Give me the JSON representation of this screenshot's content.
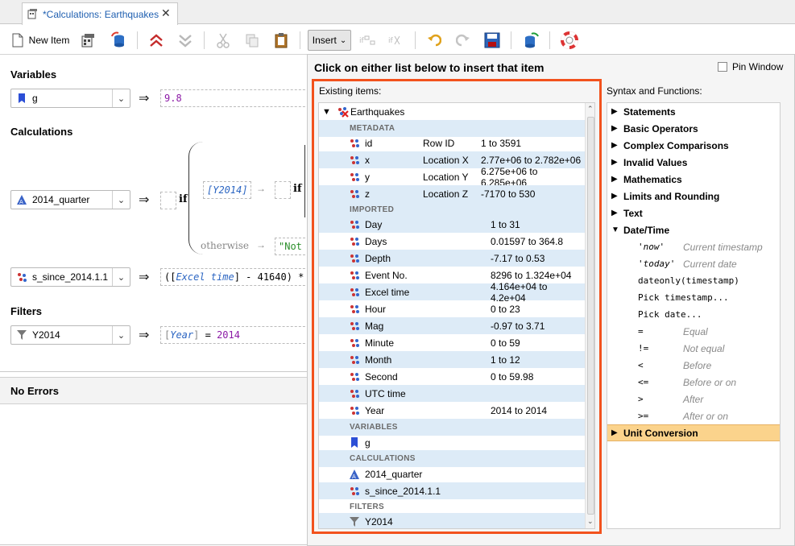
{
  "tab": {
    "title": "*Calculations: Earthquakes",
    "close": "✕"
  },
  "toolbar": {
    "new_item": "New Item",
    "insert": "Insert",
    "insert_caret": "⌄"
  },
  "left": {
    "variables_title": "Variables",
    "calculations_title": "Calculations",
    "filters_title": "Filters",
    "errors_title": "No Errors",
    "var_g": {
      "name": "g",
      "value": "9.8"
    },
    "calc_quarter": {
      "name": "2014_quarter",
      "if": "if",
      "cond": "[Y2014]",
      "arrow_if": "→",
      "if2": "if",
      "otherwise": "otherwise",
      "not_text": "\"Not"
    },
    "calc_ssince": {
      "name": "s_since_2014.1.1",
      "expr_open": "([",
      "expr_var": "Excel  time",
      "expr_rest": "] - 41640) *"
    },
    "filter_y2014": {
      "name": "Y2014",
      "expr_open": "[",
      "expr_var": "Year",
      "expr_close": "]",
      "expr_op": " = ",
      "expr_val": "2014"
    },
    "implies": "⇒"
  },
  "popup": {
    "heading": "Click on either list below to insert that item",
    "pin_label": "Pin Window",
    "existing_label": "Existing items:",
    "syntax_label": "Syntax and Functions:",
    "root": "Earthquakes",
    "groups": {
      "metadata": "METADATA",
      "imported": "IMPORTED",
      "variables": "VARIABLES",
      "calculations": "CALCULATIONS",
      "filters": "FILTERS"
    },
    "metadata": [
      {
        "name": "id",
        "role": "Row ID",
        "range": "1 to 3591"
      },
      {
        "name": "x",
        "role": "Location X",
        "range": "2.77e+06 to 2.782e+06"
      },
      {
        "name": "y",
        "role": "Location Y",
        "range": "6.275e+06 to 6.285e+06"
      },
      {
        "name": "z",
        "role": "Location Z",
        "range": "-7170 to 530"
      }
    ],
    "imported": [
      {
        "name": "Day",
        "range": "1 to 31"
      },
      {
        "name": "Days",
        "range": "0.01597 to 364.8"
      },
      {
        "name": "Depth",
        "range": "-7.17 to 0.53"
      },
      {
        "name": "Event No.",
        "range": "8296 to 1.324e+04"
      },
      {
        "name": "Excel  time",
        "range": "4.164e+04 to 4.2e+04"
      },
      {
        "name": "Hour",
        "range": "0 to 23"
      },
      {
        "name": "Mag",
        "range": "-0.97 to 3.71"
      },
      {
        "name": "Minute",
        "range": "0 to 59"
      },
      {
        "name": "Month",
        "range": "1 to 12"
      },
      {
        "name": "Second",
        "range": "0 to 59.98"
      },
      {
        "name": "UTC time",
        "range": ""
      },
      {
        "name": "Year",
        "range": "2014 to 2014"
      }
    ],
    "variables": [
      {
        "name": "g"
      }
    ],
    "calculations": [
      {
        "name": "2014_quarter"
      },
      {
        "name": "s_since_2014.1.1"
      }
    ],
    "filters": [
      {
        "name": "Y2014"
      }
    ],
    "syntax": [
      {
        "label": "Statements"
      },
      {
        "label": "Basic Operators"
      },
      {
        "label": "Complex Comparisons"
      },
      {
        "label": "Invalid Values"
      },
      {
        "label": "Mathematics"
      },
      {
        "label": "Limits and Rounding"
      },
      {
        "label": "Text"
      },
      {
        "label": "Date/Time"
      },
      {
        "label": "Unit Conversion"
      }
    ],
    "datetime_items": [
      {
        "code": "'now'",
        "desc": "Current timestamp"
      },
      {
        "code": "'today'",
        "desc": "Current date"
      },
      {
        "code": "dateonly(timestamp)",
        "desc": ""
      },
      {
        "code": "Pick timestamp...",
        "desc": ""
      },
      {
        "code": "Pick date...",
        "desc": ""
      },
      {
        "code": "=",
        "desc": "Equal"
      },
      {
        "code": "!=",
        "desc": "Not equal"
      },
      {
        "code": "<",
        "desc": "Before"
      },
      {
        "code": "<=",
        "desc": "Before or on"
      },
      {
        "code": ">",
        "desc": "After"
      },
      {
        "code": ">=",
        "desc": "After or on"
      }
    ]
  }
}
